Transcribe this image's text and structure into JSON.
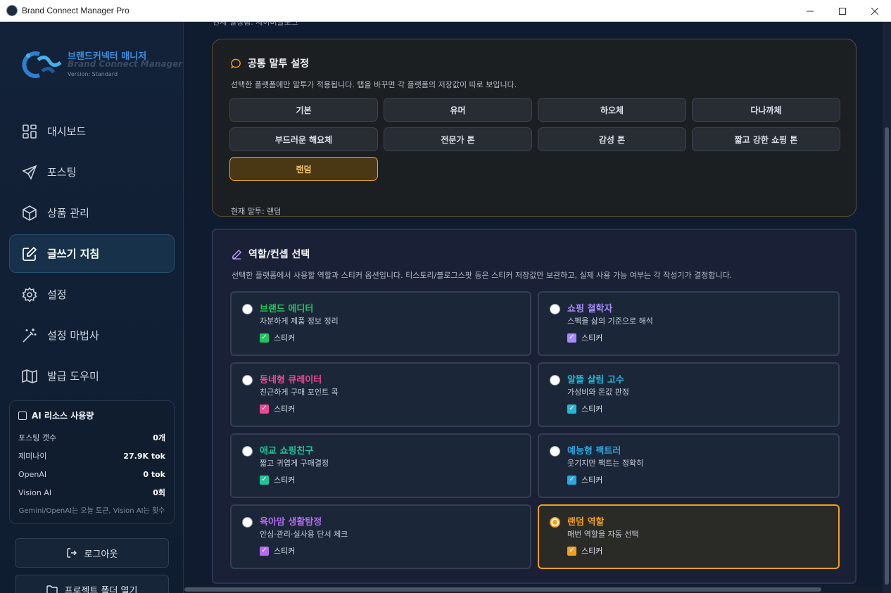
{
  "window": {
    "title": "Brand Connect Manager Pro",
    "minimize": "—",
    "maximize": "☐",
    "close": "✕"
  },
  "logo": {
    "brand_ko": "브랜드커넥터 매니저",
    "brand_en": "Brand Connect Manager",
    "version": "Version: Standard"
  },
  "sidebar": {
    "items": [
      {
        "label": "대시보드",
        "icon": "grid-icon"
      },
      {
        "label": "포스팅",
        "icon": "send-icon"
      },
      {
        "label": "상품 관리",
        "icon": "box-icon"
      },
      {
        "label": "글쓰기 지침",
        "icon": "edit-icon",
        "active": true
      },
      {
        "label": "설정",
        "icon": "gear-icon"
      },
      {
        "label": "설정 마법사",
        "icon": "magic-wand-icon"
      },
      {
        "label": "발급 도우미",
        "icon": "map-icon"
      }
    ],
    "usage": {
      "title": "AI 리소스 사용량",
      "rows": [
        {
          "label": "포스팅 갯수",
          "value": "0개"
        },
        {
          "label": "제미나이",
          "value": "27.9K tok"
        },
        {
          "label": "OpenAI",
          "value": "0 tok"
        },
        {
          "label": "Vision AI",
          "value": "0회"
        }
      ],
      "note": "Gemini/OpenAI는 오늘 토큰, Vision AI는 횟수"
    },
    "logout_label": "로그아웃",
    "open_folder_label": "프로젝트 폴더 열기"
  },
  "main": {
    "cutoff_text": "현재 설정됨: 제이버블로그",
    "tone": {
      "title": "공통 말투 설정",
      "description": "선택한 플랫폼에만 말투가 적용됩니다. 탭을 바꾸면 각 플랫폼의 저장값이 따로 보입니다.",
      "options": [
        "기본",
        "유머",
        "하오체",
        "다나까체",
        "부드러운 해요체",
        "전문가 톤",
        "감성 톤",
        "짧고 강한 쇼핑 톤",
        "랜덤"
      ],
      "selected_index": 8,
      "current": "현재 말투: 랜덤"
    },
    "role": {
      "title": "역할/컨셉 선택",
      "description": "선택한 플랫폼에서 사용할 역할과 스티커 옵션입니다. 티스토리/블로그스팟 등은 스티커 저장값만 보관하고, 실제 사용 가능 여부는 각 작성기가 결정합니다.",
      "sticker_label": "스티커",
      "roles": [
        {
          "name": "브랜드 에디터",
          "desc": "차분하게 제품 정보 정리",
          "color": "#22c55e",
          "selected": false
        },
        {
          "name": "쇼핑 철학자",
          "desc": "스펙을 삶의 기준으로 해석",
          "color": "#a78bfa",
          "selected": false
        },
        {
          "name": "동네형 큐레이터",
          "desc": "친근하게 구매 포인트 콕",
          "color": "#ec4899",
          "selected": false
        },
        {
          "name": "알뜰 살림 고수",
          "desc": "가성비와 돈값 판정",
          "color": "#22b8d8",
          "selected": false
        },
        {
          "name": "애교 쇼핑친구",
          "desc": "짧고 귀엽게 구매결정",
          "color": "#22c59a",
          "selected": false
        },
        {
          "name": "예능형 팩트러",
          "desc": "웃기지만 팩트는 정확히",
          "color": "#2aa8e0",
          "selected": false
        },
        {
          "name": "육아맘 생활탐정",
          "desc": "안심·관리·실사용 단서 체크",
          "color": "#b36cf0",
          "selected": false
        },
        {
          "name": "랜덤 역할",
          "desc": "매번 역할을 자동 선택",
          "color": "#f2a01c",
          "selected": true
        }
      ]
    }
  },
  "colors": {
    "accent": "#f2a01c",
    "sidebar_bg": "#132238",
    "main_bg": "#0f1b2e"
  }
}
